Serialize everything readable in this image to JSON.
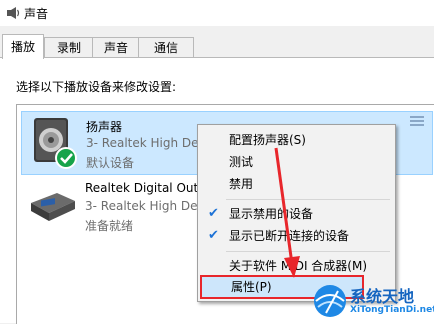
{
  "window": {
    "title": "声音"
  },
  "tabs": [
    {
      "label": "播放",
      "active": true
    },
    {
      "label": "录制",
      "active": false
    },
    {
      "label": "声音",
      "active": false
    },
    {
      "label": "通信",
      "active": false
    }
  ],
  "instruction": "选择以下播放设备来修改设置:",
  "devices": [
    {
      "name": "扬声器",
      "description": "3- Realtek High De",
      "status": "默认设备",
      "icon": "speaker-icon",
      "selected": true
    },
    {
      "name": "Realtek Digital Out",
      "description": "3- Realtek High De",
      "status": "准备就绪",
      "icon": "digital-output-icon",
      "selected": false
    }
  ],
  "context_menu": {
    "items": [
      {
        "label": "配置扬声器(S)",
        "checked": false
      },
      {
        "label": "测试",
        "checked": false
      },
      {
        "label": "禁用",
        "checked": false
      },
      {
        "label": "显示禁用的设备",
        "checked": true
      },
      {
        "label": "显示已断开连接的设备",
        "checked": true
      },
      {
        "label": "关于软件 MIDI 合成器(M)",
        "checked": false
      },
      {
        "label": "属性(P)",
        "checked": false,
        "highlighted": true
      }
    ]
  },
  "watermark": {
    "text_cn": "系统天地",
    "text_en": "XiTongTianDi.net"
  },
  "colors": {
    "selection": "#cce8ff",
    "highlight_border": "#e8262b",
    "check": "#1d72d6",
    "arrow": "#e8262b"
  }
}
